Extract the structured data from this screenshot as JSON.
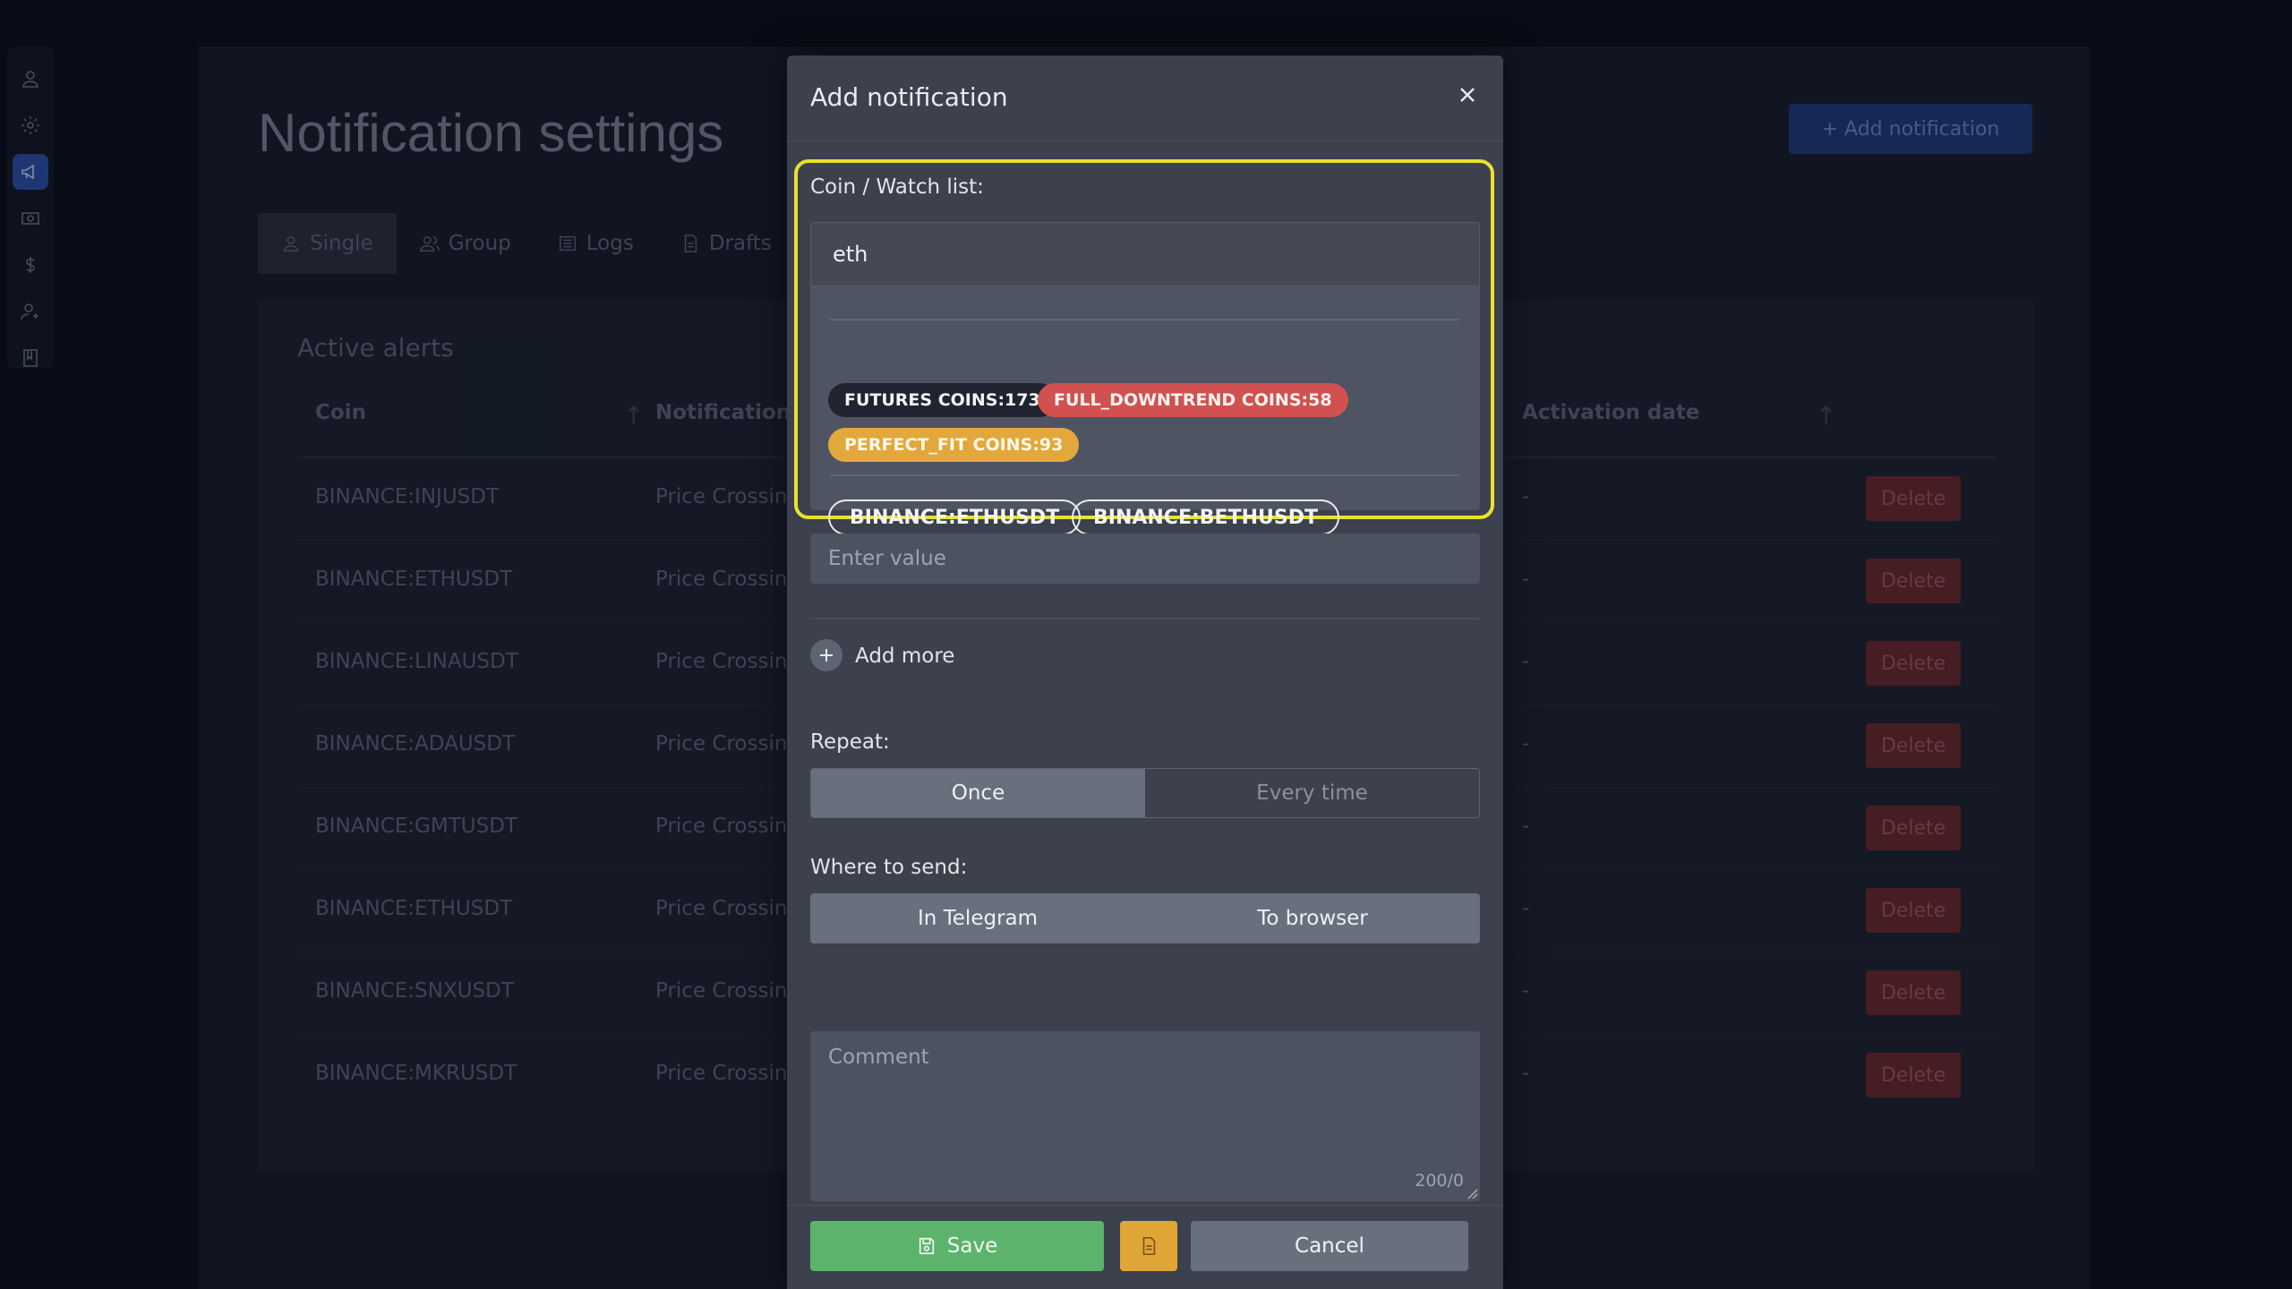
{
  "sidebar": {
    "items": [
      {
        "icon": "user-icon"
      },
      {
        "icon": "gear-icon"
      },
      {
        "icon": "megaphone-icon",
        "active": true
      },
      {
        "icon": "money-icon"
      },
      {
        "icon": "dollar-icon"
      },
      {
        "icon": "add-user-icon"
      },
      {
        "icon": "book-icon"
      }
    ]
  },
  "page": {
    "title": "Notification settings",
    "add_button_label": "+ Add notification",
    "tabs": [
      {
        "label": "Single",
        "icon": "user-icon"
      },
      {
        "label": "Group",
        "icon": "users-icon"
      },
      {
        "label": "Logs",
        "icon": "list-icon"
      },
      {
        "label": "Drafts",
        "icon": "document-icon"
      }
    ],
    "alerts": {
      "title": "Active alerts",
      "columns": {
        "coin": "Coin",
        "type": "Notification ty",
        "date": "Activation date"
      },
      "delete_label": "Delete",
      "rows": [
        {
          "coin": "BINANCE:INJUSDT",
          "type": "Price Crossing",
          "date": "-"
        },
        {
          "coin": "BINANCE:ETHUSDT",
          "type": "Price Crossing",
          "date": "-"
        },
        {
          "coin": "BINANCE:LINAUSDT",
          "type": "Price Crossing",
          "date": "-"
        },
        {
          "coin": "BINANCE:ADAUSDT",
          "type": "Price Crossing",
          "date": "-"
        },
        {
          "coin": "BINANCE:GMTUSDT",
          "type": "Price Crossing",
          "date": "-"
        },
        {
          "coin": "BINANCE:ETHUSDT",
          "type": "Price Crossing",
          "date": "-"
        },
        {
          "coin": "BINANCE:SNXUSDT",
          "type": "Price Crossing",
          "date": "-"
        },
        {
          "coin": "BINANCE:MKRUSDT",
          "type": "Price Crossing",
          "date": "-"
        }
      ]
    }
  },
  "modal": {
    "title": "Add notification",
    "coin_label": "Coin / Watch list:",
    "coin_value": "eth",
    "watchlists": [
      {
        "label": "FUTURES COINS:173",
        "style": "dark"
      },
      {
        "label": "FULL_DOWNTREND COINS:58",
        "style": "red"
      },
      {
        "label": "PERFECT_FIT COINS:93",
        "style": "yellow"
      }
    ],
    "coins": [
      "BINANCE:ETHUSDT",
      "BINANCE:BETHUSDT"
    ],
    "value_placeholder": "Enter value",
    "add_more_label": "Add more",
    "repeat_label": "Repeat:",
    "repeat_options": [
      "Once",
      "Every time"
    ],
    "send_label": "Where to send:",
    "send_options": [
      "In Telegram",
      "To browser"
    ],
    "comment_placeholder": "Comment",
    "comment_counter": "200/0",
    "save_label": "Save",
    "cancel_label": "Cancel"
  },
  "colors": {
    "highlight": "#e8e22e",
    "save": "#5cb36c",
    "draft": "#e0a635",
    "delete": "#6b2830",
    "active_nav": "#2c4fa8"
  }
}
